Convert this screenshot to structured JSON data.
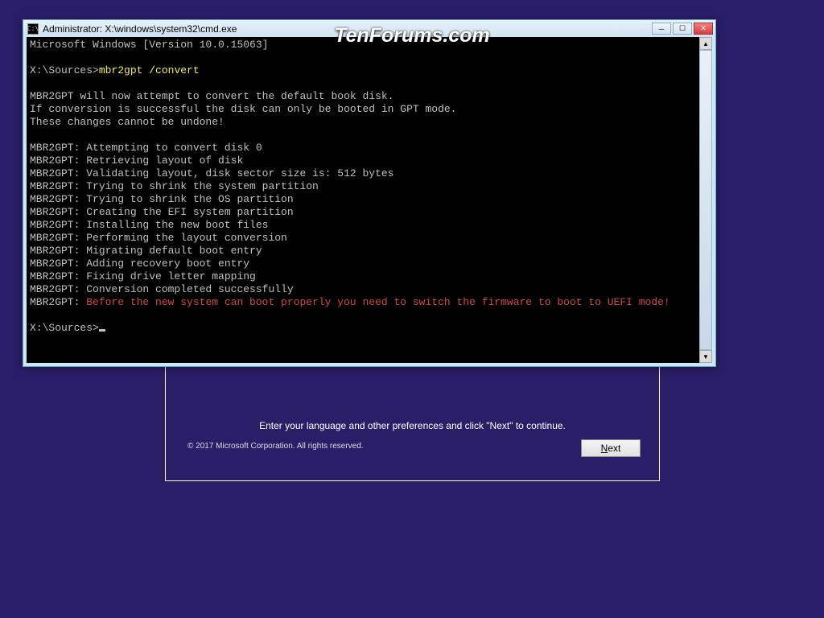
{
  "window": {
    "title": "Administrator: X:\\windows\\system32\\cmd.exe"
  },
  "watermark": "TenForums.com",
  "setup": {
    "message": "Enter your language and other preferences and click \"Next\" to continue.",
    "copyright": "© 2017 Microsoft Corporation. All rights reserved.",
    "next_label": "Next"
  },
  "cmd": {
    "version_line": "Microsoft Windows [Version 10.0.15063]",
    "prompt1": "X:\\Sources>",
    "command": "mbr2gpt /convert",
    "lines": [
      "",
      "MBR2GPT will now attempt to convert the default book disk.",
      "If conversion is successful the disk can only be booted in GPT mode.",
      "These changes cannot be undone!",
      "",
      "MBR2GPT: Attempting to convert disk 0",
      "MBR2GPT: Retrieving layout of disk",
      "MBR2GPT: Validating layout, disk sector size is: 512 bytes",
      "MBR2GPT: Trying to shrink the system partition",
      "MBR2GPT: Trying to shrink the OS partition",
      "MBR2GPT: Creating the EFI system partition",
      "MBR2GPT: Installing the new boot files",
      "MBR2GPT: Performing the layout conversion",
      "MBR2GPT: Migrating default boot entry",
      "MBR2GPT: Adding recovery boot entry",
      "MBR2GPT: Fixing drive letter mapping",
      "MBR2GPT: Conversion completed successfully"
    ],
    "warn_prefix": "MBR2GPT: ",
    "warn_text": "Before the new system can boot properly you need to switch the firmware to boot to UEFI mode!",
    "prompt2": "X:\\Sources>"
  }
}
